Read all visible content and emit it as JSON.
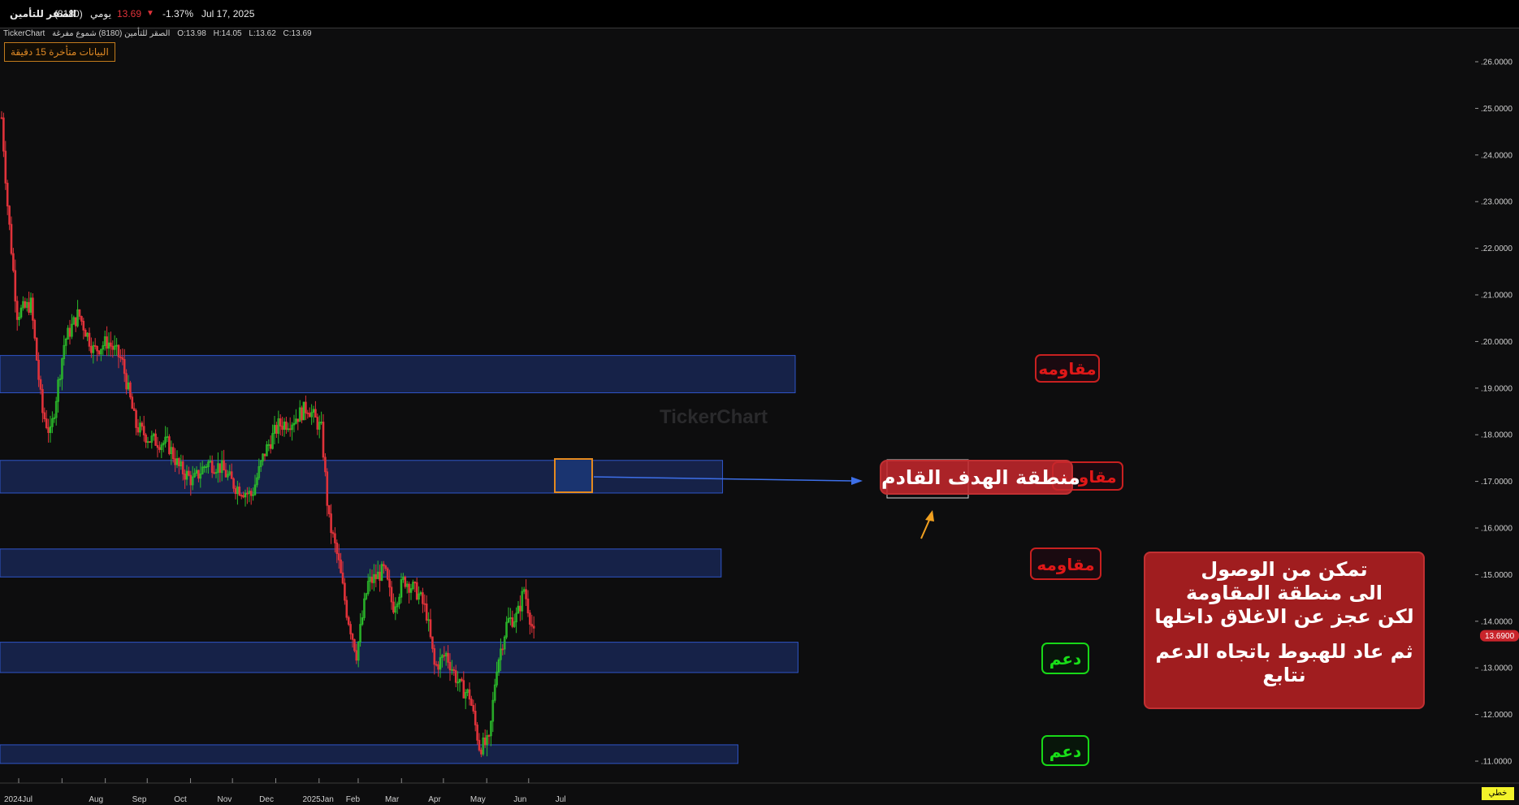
{
  "header": {
    "symbol_name": "الصقر للتأمين",
    "symbol_code": "(8180)",
    "period": "يومي",
    "price": "13.69",
    "change_pct": "-1.37%",
    "date": "Jul 17, 2025",
    "down_color": "#e0323a"
  },
  "subheader": {
    "brand": "TickerChart",
    "series_name": "الصقر للتأمين (8180) شموع مفرغة",
    "open": "O:13.98",
    "high": "H:14.05",
    "low": "L:13.62",
    "close": "C:13.69"
  },
  "delay_notice": "البيانات متأخرة 15 دقيقة",
  "watermark": "TickerChart",
  "annotations": {
    "resistance_1": "مقاومه",
    "resistance_2": "مقاومه",
    "resistance_3": "مقاومه",
    "support_1": "دعم",
    "support_2": "دعم",
    "target_zone": "منطقة الهدف القادم",
    "note_lines": [
      "تمكن   من الوصول",
      "الى منطقة المقاومة",
      "لكن عجز عن الاغلاق داخلها",
      "",
      "ثم عاد للهبوط باتجاه الدعم",
      "نتابع"
    ]
  },
  "price_tag": "13.6900",
  "bottom_tag": "خطي",
  "chart_data": {
    "type": "candlestick",
    "title": "الصقر للتأمين (8180)",
    "interval": "يومي",
    "x_axis_labels": [
      "2024Jul",
      "Aug",
      "Sep",
      "Oct",
      "Nov",
      "Dec",
      "2025Jan",
      "Feb",
      "Mar",
      "Apr",
      "May",
      "Jun",
      "Jul"
    ],
    "y_ticks": [
      "26.0000",
      "25.0000",
      "24.0000",
      "23.0000",
      "22.0000",
      "21.0000",
      "20.0000",
      "19.0000",
      "18.0000",
      "17.0000",
      "16.0000",
      "15.0000",
      "14.0000",
      "13.0000",
      "12.0000",
      "11.0000"
    ],
    "ylim": [
      10.7,
      26.2
    ],
    "last_close": 13.69,
    "colors": {
      "up": "#2bbb2b",
      "down": "#e0323a",
      "zone_fill": "#1a2a5c",
      "zone_border": "#2f55c8",
      "resistance_label": "#e01818",
      "support_label": "#18e018"
    },
    "monthly_path": [
      {
        "date": "2024-07-01",
        "price": 24.8
      },
      {
        "date": "2024-07-05",
        "price": 23.0
      },
      {
        "date": "2024-07-12",
        "price": 20.6
      },
      {
        "date": "2024-07-22",
        "price": 20.8
      },
      {
        "date": "2024-07-30",
        "price": 18.5
      },
      {
        "date": "2024-08-05",
        "price": 18.0
      },
      {
        "date": "2024-08-15",
        "price": 20.0
      },
      {
        "date": "2024-08-25",
        "price": 20.6
      },
      {
        "date": "2024-09-05",
        "price": 19.8
      },
      {
        "date": "2024-09-15",
        "price": 20.0
      },
      {
        "date": "2024-09-25",
        "price": 19.6
      },
      {
        "date": "2024-10-05",
        "price": 18.2
      },
      {
        "date": "2024-10-15",
        "price": 17.9
      },
      {
        "date": "2024-10-28",
        "price": 17.8
      },
      {
        "date": "2024-11-05",
        "price": 17.3
      },
      {
        "date": "2024-11-15",
        "price": 17.0
      },
      {
        "date": "2024-11-25",
        "price": 17.4
      },
      {
        "date": "2024-12-05",
        "price": 17.3
      },
      {
        "date": "2024-12-15",
        "price": 16.9
      },
      {
        "date": "2024-12-27",
        "price": 16.7
      },
      {
        "date": "2025-01-05",
        "price": 17.6
      },
      {
        "date": "2025-01-15",
        "price": 18.2
      },
      {
        "date": "2025-01-25",
        "price": 18.3
      },
      {
        "date": "2025-02-05",
        "price": 18.6
      },
      {
        "date": "2025-02-15",
        "price": 18.1
      },
      {
        "date": "2025-02-20",
        "price": 16.2
      },
      {
        "date": "2025-02-27",
        "price": 15.3
      },
      {
        "date": "2025-03-05",
        "price": 14.2
      },
      {
        "date": "2025-03-12",
        "price": 13.3
      },
      {
        "date": "2025-03-20",
        "price": 14.8
      },
      {
        "date": "2025-04-01",
        "price": 15.1
      },
      {
        "date": "2025-04-07",
        "price": 14.3
      },
      {
        "date": "2025-04-15",
        "price": 14.9
      },
      {
        "date": "2025-04-25",
        "price": 14.6
      },
      {
        "date": "2025-05-01",
        "price": 14.2
      },
      {
        "date": "2025-05-07",
        "price": 13.0
      },
      {
        "date": "2025-05-15",
        "price": 13.3
      },
      {
        "date": "2025-05-25",
        "price": 12.6
      },
      {
        "date": "2025-06-01",
        "price": 12.4
      },
      {
        "date": "2025-06-08",
        "price": 11.3
      },
      {
        "date": "2025-06-15",
        "price": 11.4
      },
      {
        "date": "2025-06-20",
        "price": 13.0
      },
      {
        "date": "2025-06-28",
        "price": 14.0
      },
      {
        "date": "2025-07-05",
        "price": 14.1
      },
      {
        "date": "2025-07-10",
        "price": 14.7
      },
      {
        "date": "2025-07-17",
        "price": 13.69
      }
    ],
    "zones": [
      {
        "type": "resistance",
        "from": 18.9,
        "to": 19.7,
        "start": "2024-07-01",
        "end": "2026-01-20"
      },
      {
        "type": "resistance",
        "from": 16.75,
        "to": 17.45,
        "start": "2024-07-01",
        "end": "2025-11-29"
      },
      {
        "type": "resistance",
        "from": 14.95,
        "to": 15.55,
        "start": "2024-07-01",
        "end": "2025-11-28"
      },
      {
        "type": "support",
        "from": 12.9,
        "to": 13.55,
        "start": "2024-07-01",
        "end": "2026-01-22"
      },
      {
        "type": "support",
        "from": 10.95,
        "to": 11.35,
        "start": "2024-07-01",
        "end": "2025-12-10"
      }
    ]
  }
}
